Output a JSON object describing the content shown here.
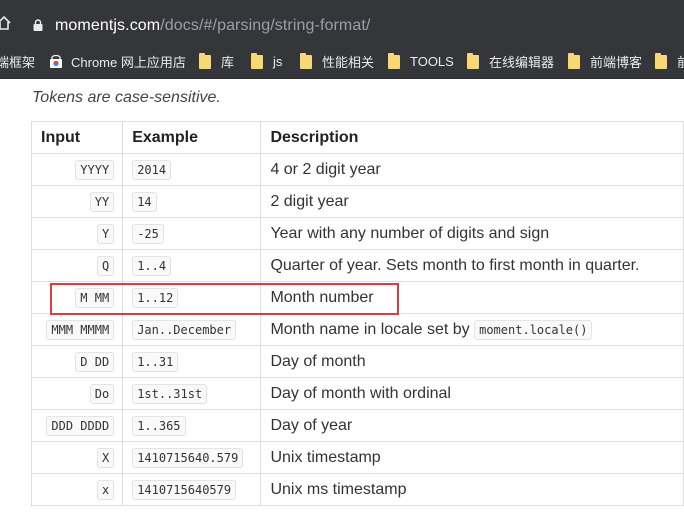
{
  "browser": {
    "url_host": "momentjs.com",
    "url_path": "/docs/#/parsing/string-format/"
  },
  "bookmarks": [
    {
      "label": "端框架",
      "icon": "folder-icon"
    },
    {
      "label": "Chrome 网上应用店",
      "icon": "chrome-webstore-icon"
    },
    {
      "label": "库",
      "icon": "folder-icon"
    },
    {
      "label": "js",
      "icon": "folder-icon"
    },
    {
      "label": "性能相关",
      "icon": "folder-icon"
    },
    {
      "label": "TOOLS",
      "icon": "folder-icon"
    },
    {
      "label": "在线编辑器",
      "icon": "folder-icon"
    },
    {
      "label": "前端博客",
      "icon": "folder-icon"
    },
    {
      "label": "前",
      "icon": "folder-icon"
    }
  ],
  "intro": "Tokens are case-sensitive.",
  "table": {
    "headers": [
      "Input",
      "Example",
      "Description"
    ],
    "rows": [
      {
        "input": "YYYY",
        "example": "2014",
        "description": "4 or 2 digit year"
      },
      {
        "input": "YY",
        "example": "14",
        "description": "2 digit year"
      },
      {
        "input": "Y",
        "example": "-25",
        "description": "Year with any number of digits and sign"
      },
      {
        "input": "Q",
        "example": "1..4",
        "description": "Quarter of year. Sets month to first month in quarter."
      },
      {
        "input": "M MM",
        "example": "1..12",
        "description": "Month number"
      },
      {
        "input": "MMM MMMM",
        "example": "Jan..December",
        "description": "Month name in locale set by",
        "code": "moment.locale()"
      },
      {
        "input": "D DD",
        "example": "1..31",
        "description": "Day of month"
      },
      {
        "input": "Do",
        "example": "1st..31st",
        "description": "Day of month with ordinal"
      },
      {
        "input": "DDD DDDD",
        "example": "1..365",
        "description": "Day of year"
      },
      {
        "input": "X",
        "example": "1410715640.579",
        "description": "Unix timestamp"
      },
      {
        "input": "x",
        "example": "1410715640579",
        "description": "Unix ms timestamp"
      }
    ]
  },
  "colors": {
    "chrome_bar": "#35363a",
    "folder": "#f8d775",
    "highlight": "#e3393c"
  }
}
